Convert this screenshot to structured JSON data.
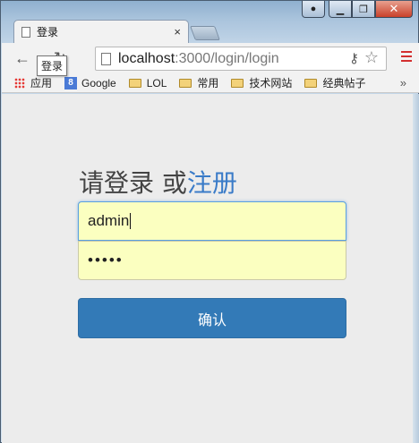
{
  "window": {
    "controls": {
      "minimize": "▁",
      "maximize": "❐",
      "close": "✕"
    }
  },
  "tab": {
    "title": "登录",
    "close": "×"
  },
  "toolbar": {
    "back": "←",
    "reload": "↻",
    "url_host": "localhost",
    "url_rest": ":3000/login/login",
    "key_icon": "key-icon",
    "star": "☆"
  },
  "tooltip": "登录",
  "bookmarks": {
    "items": [
      "应用",
      "Google",
      "LOL",
      "常用",
      "技术网站",
      "经典帖子"
    ],
    "more": "»"
  },
  "page": {
    "heading_prefix": "请登录 或",
    "heading_link": "注册",
    "username_value": "admin",
    "password_value": "•••••",
    "confirm_label": "确认"
  },
  "colors": {
    "primary_button": "#337ab7",
    "link": "#3a7bc8",
    "autofill": "#fbffc0"
  }
}
